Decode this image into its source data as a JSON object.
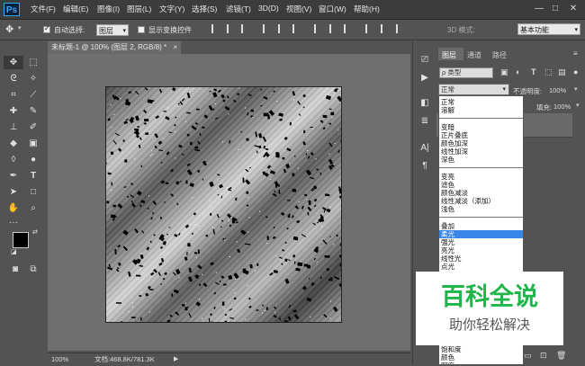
{
  "app": {
    "logo": "Ps"
  },
  "menu": {
    "items": [
      "文件(F)",
      "编辑(E)",
      "图像(I)",
      "图层(L)",
      "文字(Y)",
      "选择(S)",
      "滤镜(T)",
      "3D(D)",
      "视图(V)",
      "窗口(W)",
      "帮助(H)"
    ]
  },
  "window_buttons": {
    "minimize": "—",
    "maximize": "□",
    "close": "✕"
  },
  "options": {
    "auto_select_label": "自动选择:",
    "auto_select_value": "图层",
    "show_transform_label": "显示变换控件",
    "mode_3d_label": "3D 模式:",
    "workspace_value": "基本功能"
  },
  "document": {
    "tab_title": "未标题-1 @ 100% (图层 2, RGB/8) *",
    "tab_close": "×",
    "zoom": "100%",
    "doc_info": "文档:468.8K/781.3K"
  },
  "panel": {
    "tabs": [
      "图层",
      "通道",
      "路径"
    ],
    "kind_filter": "ρ 类型",
    "blend_mode_value": "正常",
    "opacity_label": "不透明度:",
    "opacity_value": "100%",
    "fill_label": "填充:",
    "fill_value": "100%"
  },
  "blend_modes": {
    "group1": [
      "正常",
      "溶解"
    ],
    "group2": [
      "变暗",
      "正片叠底",
      "颜色加深",
      "线性加深",
      "深色"
    ],
    "group3": [
      "变亮",
      "滤色",
      "颜色减淡",
      "线性减淡（添加）",
      "浅色"
    ],
    "group4": [
      "叠加",
      "柔光",
      "强光",
      "亮光",
      "线性光",
      "点光"
    ],
    "group_bottom": [
      "色相",
      "饱和度",
      "颜色",
      "明度"
    ],
    "selected": "柔光"
  },
  "watermark": {
    "title": "百科全说",
    "subtitle": "助你轻松解决"
  },
  "colors": {
    "accent": "#31a8ff",
    "selection": "#3a86e6",
    "watermark_green": "#20b54a"
  }
}
